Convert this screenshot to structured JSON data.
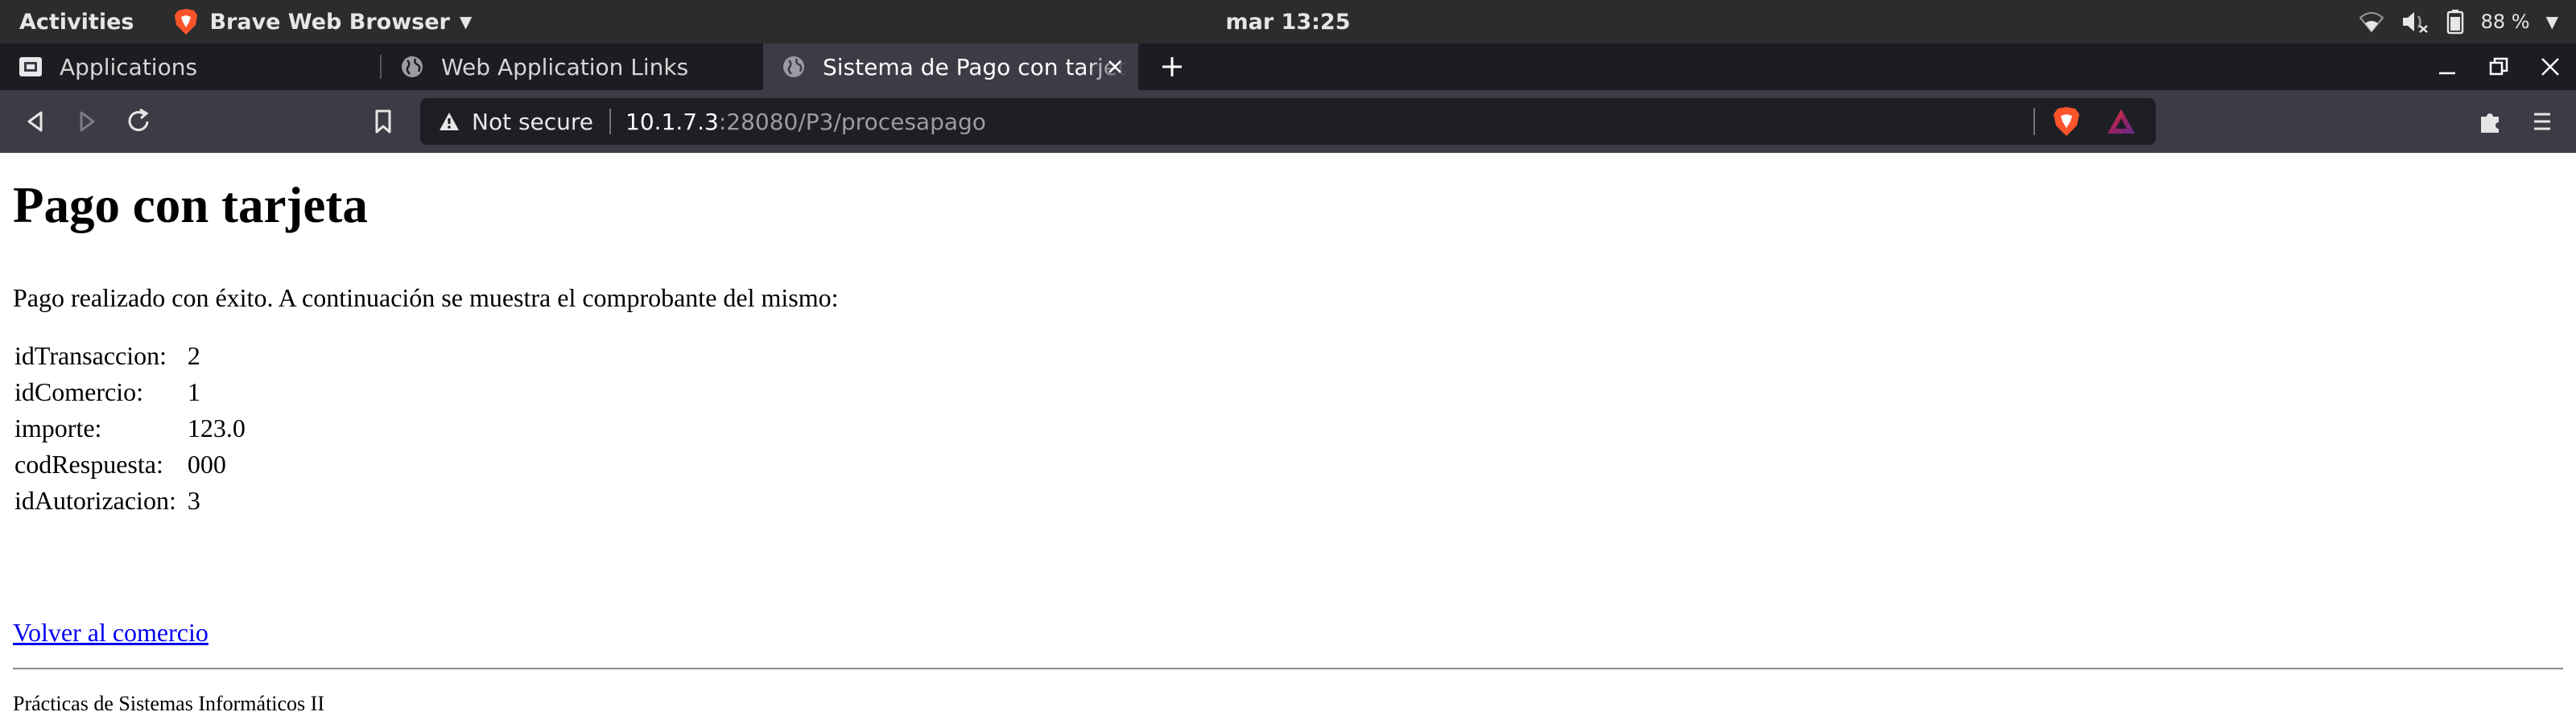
{
  "system_bar": {
    "activities": "Activities",
    "app_name": "Brave Web Browser",
    "clock": "mar 13:25",
    "battery": "88 %"
  },
  "tabs": [
    {
      "title": "Applications",
      "icon": "applications-icon",
      "active": false
    },
    {
      "title": "Web Application Links",
      "icon": "globe-icon",
      "active": false
    },
    {
      "title": "Sistema de Pago con tarjeta",
      "icon": "globe-icon",
      "active": true
    }
  ],
  "address_bar": {
    "security_label": "Not secure",
    "url_host": "10.1.7.3",
    "url_rest": ":28080/P3/procesapago"
  },
  "page": {
    "heading": "Pago con tarjeta",
    "intro": "Pago realizado con éxito. A continuación se muestra el comprobante del mismo:",
    "receipt": [
      {
        "label": "idTransaccion:",
        "value": "2"
      },
      {
        "label": "idComercio:",
        "value": "1"
      },
      {
        "label": "importe:",
        "value": "123.0"
      },
      {
        "label": "codRespuesta:",
        "value": "000"
      },
      {
        "label": "idAutorizacion:",
        "value": "3"
      }
    ],
    "back_link": "Volver al comercio",
    "footer": "Prácticas de Sistemas Informáticos II"
  },
  "colors": {
    "topbar": "#2c2c2c",
    "tabstrip": "#1c1d22",
    "toolbar": "#3b3c45",
    "link": "#0000ee",
    "brave_orange": "#fb542b"
  }
}
